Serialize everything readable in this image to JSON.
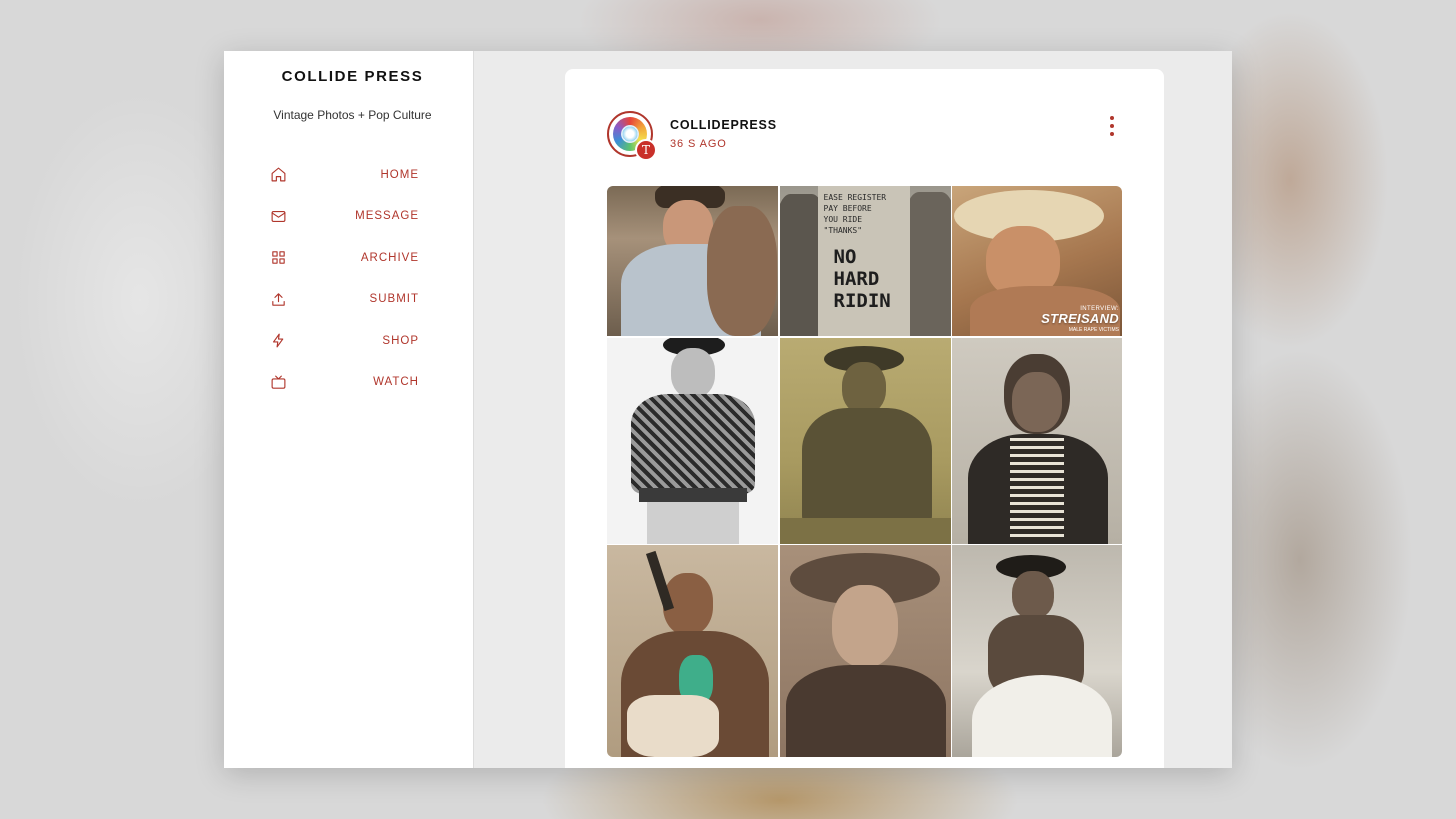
{
  "sidebar": {
    "title": "COLLIDE PRESS",
    "description": "Vintage Photos + Pop Culture",
    "nav": [
      {
        "label": "HOME",
        "icon": "home-icon"
      },
      {
        "label": "MESSAGE",
        "icon": "mail-icon"
      },
      {
        "label": "ARCHIVE",
        "icon": "grid-icon"
      },
      {
        "label": "SUBMIT",
        "icon": "upload-icon"
      },
      {
        "label": "SHOP",
        "icon": "lightning-icon"
      },
      {
        "label": "WATCH",
        "icon": "tv-icon"
      }
    ]
  },
  "post": {
    "author": "COLLIDEPRESS",
    "time": "36 S AGO",
    "avatar_badge": "T",
    "photos": {
      "sign_lines": [
        "EASE REGISTER",
        "PAY BEFORE",
        "YOU RIDE",
        "\"THANKS\""
      ],
      "sign_big": [
        "NO",
        "HARD",
        "RIDIN"
      ],
      "magazine_kicker": "INTERVIEW:",
      "magazine_title": "STREISAND",
      "magazine_tag": "MALE RAPE VICTIMS"
    }
  },
  "colors": {
    "accent": "#b0362c",
    "background": "#ebebeb",
    "card": "#ffffff"
  }
}
